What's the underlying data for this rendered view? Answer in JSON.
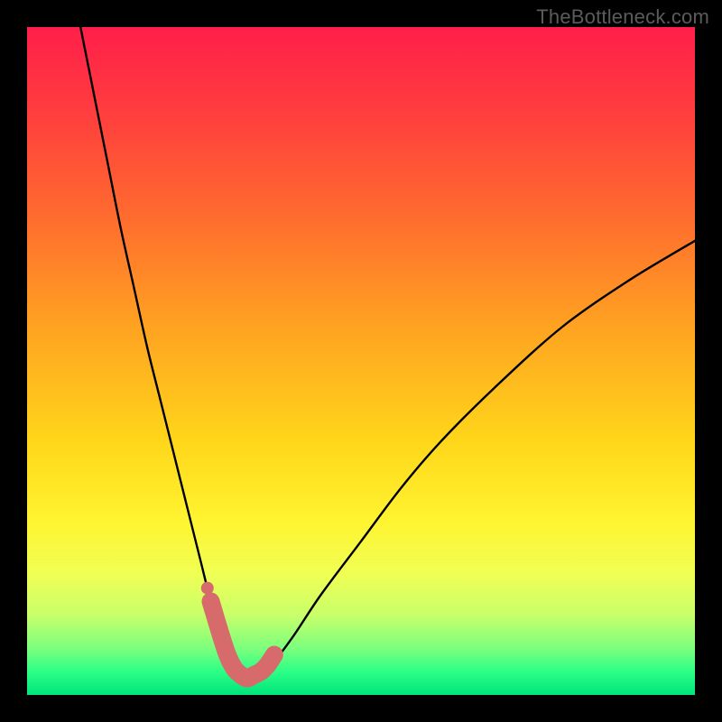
{
  "watermark": "TheBottleneck.com",
  "colors": {
    "frame_bg": "#000000",
    "gradient_stops": [
      {
        "offset": 0.0,
        "color": "#ff1f4a"
      },
      {
        "offset": 0.12,
        "color": "#ff3b3f"
      },
      {
        "offset": 0.28,
        "color": "#ff6a2f"
      },
      {
        "offset": 0.45,
        "color": "#ffa321"
      },
      {
        "offset": 0.62,
        "color": "#ffd61a"
      },
      {
        "offset": 0.74,
        "color": "#fff430"
      },
      {
        "offset": 0.82,
        "color": "#f0ff55"
      },
      {
        "offset": 0.88,
        "color": "#c8ff6a"
      },
      {
        "offset": 0.93,
        "color": "#7dff7d"
      },
      {
        "offset": 0.965,
        "color": "#2cff86"
      },
      {
        "offset": 1.0,
        "color": "#00e57a"
      }
    ],
    "curve": "#000000",
    "marker_fill": "#d76b6b",
    "marker_stroke": "#d76b6b"
  },
  "chart_data": {
    "type": "line",
    "title": "",
    "xlabel": "",
    "ylabel": "",
    "xlim": [
      0,
      100
    ],
    "ylim": [
      0,
      100
    ],
    "grid": false,
    "legend": false,
    "series": [
      {
        "name": "bottleneck-curve",
        "x": [
          8,
          10,
          12,
          14,
          16,
          18,
          20,
          22,
          24,
          26,
          27.5,
          29,
          30.5,
          32,
          33.5,
          35,
          37,
          40,
          44,
          50,
          56,
          62,
          70,
          80,
          90,
          100
        ],
        "y": [
          100,
          90,
          80,
          70,
          61,
          52,
          44,
          36,
          28,
          20,
          14,
          9,
          5,
          3,
          2.5,
          3,
          5,
          9,
          15,
          23,
          31,
          38,
          46,
          55,
          62,
          68
        ]
      }
    ],
    "markers": {
      "name": "highlight-band",
      "x": [
        27.5,
        29,
        30,
        31,
        32,
        33,
        34,
        35,
        36,
        37
      ],
      "y": [
        14,
        9,
        6,
        4,
        3,
        2.5,
        3,
        3.5,
        4.5,
        6
      ]
    },
    "single_marker": {
      "x": 27,
      "y": 16
    }
  }
}
